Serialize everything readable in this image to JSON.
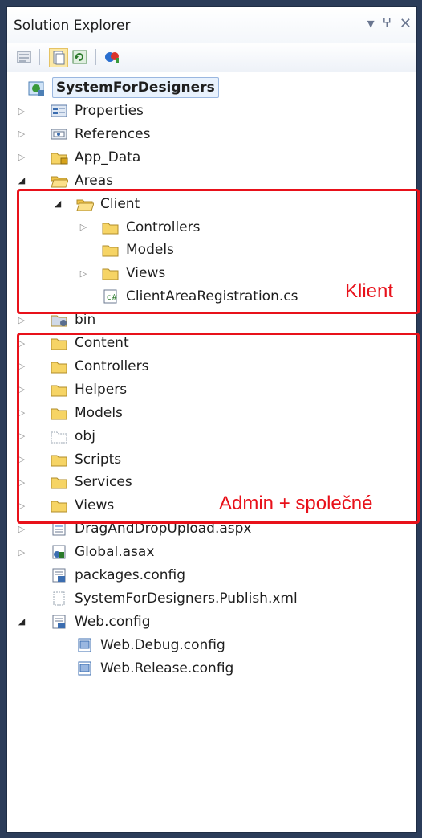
{
  "panel": {
    "title": "Solution Explorer",
    "controls": [
      "▾",
      "ꟷ",
      "✕"
    ]
  },
  "toolbar": {
    "buttons": [
      "properties-icon",
      "show-all-files-icon",
      "refresh-icon",
      "view-class-diagram-icon"
    ]
  },
  "tree": {
    "root": "SystemForDesigners",
    "items": [
      "Properties",
      "References",
      "App_Data",
      "Areas",
      "Client",
      "Controllers",
      "Models",
      "Views",
      "ClientAreaRegistration.cs",
      "bin",
      "Content",
      "Controllers",
      "Helpers",
      "Models",
      "obj",
      "Scripts",
      "Services",
      "Views",
      "DragAndDropUpload.aspx",
      "Global.asax",
      "packages.config",
      "SystemForDesigners.Publish.xml",
      "Web.config",
      "Web.Debug.config",
      "Web.Release.config"
    ]
  },
  "annotations": {
    "client": "Klient",
    "admin": "Admin + společné"
  },
  "colors": {
    "highlight": "#e8111a",
    "frame": "#2b3c59"
  }
}
